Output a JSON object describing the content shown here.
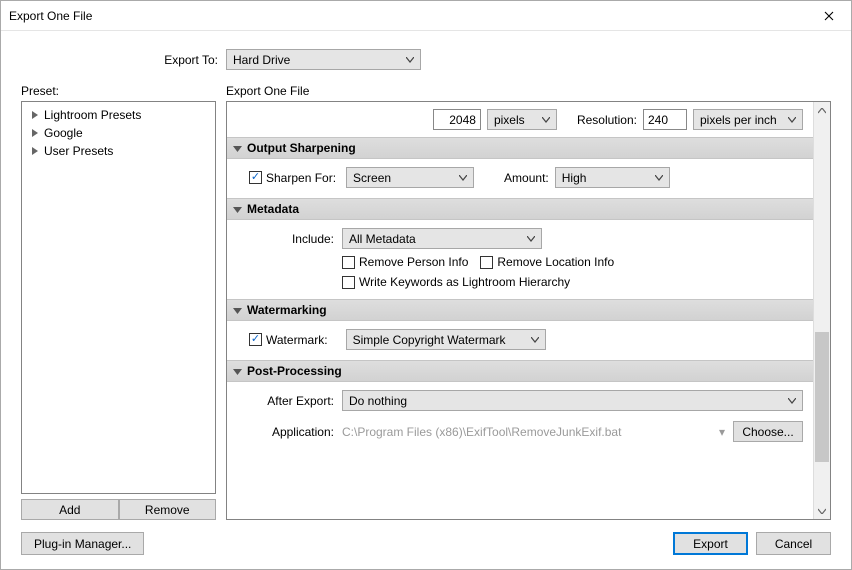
{
  "window": {
    "title": "Export One File"
  },
  "top": {
    "export_to_label": "Export To:",
    "export_to_value": "Hard Drive"
  },
  "preset": {
    "label": "Preset:",
    "items": [
      "Lightroom Presets",
      "Google",
      "User Presets"
    ],
    "add_label": "Add",
    "remove_label": "Remove"
  },
  "settings": {
    "label": "Export One File",
    "size_value": "2048",
    "size_unit": "pixels",
    "resolution_label": "Resolution:",
    "resolution_value": "240",
    "resolution_unit": "pixels per inch",
    "sections": [
      {
        "title": "Output Sharpening",
        "sharpen_label": "Sharpen For:",
        "sharpen_value": "Screen",
        "amount_label": "Amount:",
        "amount_value": "High"
      },
      {
        "title": "Metadata",
        "include_label": "Include:",
        "include_value": "All Metadata",
        "remove_person": "Remove Person Info",
        "remove_location": "Remove Location Info",
        "write_keywords": "Write Keywords as Lightroom Hierarchy"
      },
      {
        "title": "Watermarking",
        "watermark_label": "Watermark:",
        "watermark_value": "Simple Copyright Watermark"
      },
      {
        "title": "Post-Processing",
        "after_label": "After Export:",
        "after_value": "Do nothing",
        "app_label": "Application:",
        "app_value": "C:\\Program Files (x86)\\ExifTool\\RemoveJunkExif.bat",
        "choose_label": "Choose..."
      }
    ]
  },
  "footer": {
    "plugin_mgr": "Plug-in Manager...",
    "export": "Export",
    "cancel": "Cancel"
  }
}
